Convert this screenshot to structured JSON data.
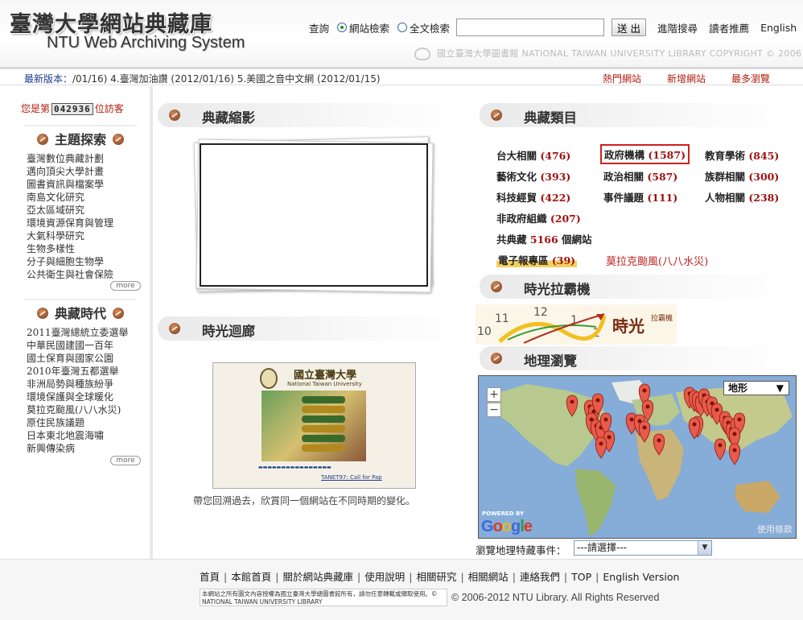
{
  "header": {
    "title": "臺灣大學網站典藏庫",
    "subtitle": "NTU Web Archiving System",
    "query_label": "查詢",
    "radio_site": "網站檢索",
    "radio_fulltext": "全文檢索",
    "search_placeholder": "",
    "submit": "送 出",
    "advanced": "進階搜尋",
    "recommend": "讀者推薦",
    "english": "English",
    "library_banner": "國立臺灣大學圖書館  NATIONAL TAIWAN UNIVERSITY LIBRARY  COPYRIGHT © 2006 -"
  },
  "news": {
    "label": "最新版本：",
    "text": "/01/16)  4.臺灣加油讚 (2012/01/16)  5.美國之音中文網 (2012/01/15)",
    "tabs": [
      "熱門網站",
      "新增網站",
      "最多瀏覽"
    ]
  },
  "visitor": {
    "prefix": "您是第",
    "count": "042936",
    "suffix": "位訪客"
  },
  "themes": {
    "title": "主題探索",
    "items": [
      "臺灣數位典藏計劃",
      "邁向頂尖大學計畫",
      "圖書資訊與檔案學",
      "南島文化研究",
      "亞太區域研究",
      "環境資源保育與管理",
      "大氣科學研究",
      "生物多樣性",
      "分子與細胞生物學",
      "公共衛生與社會保險"
    ],
    "more": "more"
  },
  "eras": {
    "title": "典藏時代",
    "items": [
      "2011臺灣總統立委選舉",
      "中華民國建國一百年",
      "國土保育與國家公園",
      "2010年臺灣五都選舉",
      "非洲局勢與種族紛爭",
      "環境保護與全球暖化",
      "莫拉克颱風(八八水災)",
      "原住民族議題",
      "日本東北地震海嘯",
      "新興傳染病"
    ],
    "more": "more"
  },
  "sections": {
    "thumbnails": "典藏縮影",
    "gallery": "時光迴廊",
    "categories": "典藏類目",
    "time_machine": "時光拉霸機",
    "geo": "地理瀏覽"
  },
  "gallery": {
    "caption": "帶您回溯過去，欣賞同一個網站在不同時期的變化。",
    "shot_title": "國立臺灣大學",
    "shot_subtitle": "National Taiwan University",
    "shot_footer": "TANET97: Call for Pap"
  },
  "categories": {
    "items": [
      {
        "name": "台大相關",
        "count": "(476)"
      },
      {
        "name": "政府機構",
        "count": "(1587)"
      },
      {
        "name": "教育學術",
        "count": "(845)"
      },
      {
        "name": "藝術文化",
        "count": "(393)"
      },
      {
        "name": "政治相關",
        "count": "(587)"
      },
      {
        "name": "族群相關",
        "count": "(300)"
      },
      {
        "name": "科技經貿",
        "count": "(422)"
      },
      {
        "name": "事件議題",
        "count": "(111)"
      },
      {
        "name": "人物相關",
        "count": "(238)"
      },
      {
        "name": "非政府組織",
        "count": "(207)"
      }
    ],
    "total_prefix": "共典藏",
    "total_count": "5166",
    "total_suffix": "個網站",
    "epaper": "電子報專區",
    "epaper_count": "(39)",
    "morakot": "莫拉克颱風(八八水災)"
  },
  "time_machine": {
    "word": "時光",
    "sub": "拉霸機",
    "numbers": [
      "10",
      "11",
      "12",
      "1",
      "2"
    ]
  },
  "map": {
    "type": "地形",
    "terms": "使用條款",
    "powered": "POWERED BY",
    "google": "Google",
    "zoom_in": "+",
    "zoom_out": "−",
    "geo_label": "瀏覽地理特藏事件：",
    "select_value": "---請選擇---"
  },
  "footer": {
    "links": [
      "首頁",
      "本館首頁",
      "關於網站典藏庫",
      "使用說明",
      "相關研究",
      "相關網站",
      "連絡我們",
      "TOP",
      "English Version"
    ],
    "notice": "本網站之所有圖文內容授權為國立臺灣大學總圖書館所有，請勿任意轉載或擷取使用。© NATIONAL TAIWAN UNIVERSITY LIBRARY",
    "copyright": "© 2006-2012 NTU Library. All Rights Reserved"
  },
  "colors": {
    "accent_red": "#a01010",
    "link_blue": "#1c3b8a",
    "bullet_brown": "#7a3a1a"
  }
}
